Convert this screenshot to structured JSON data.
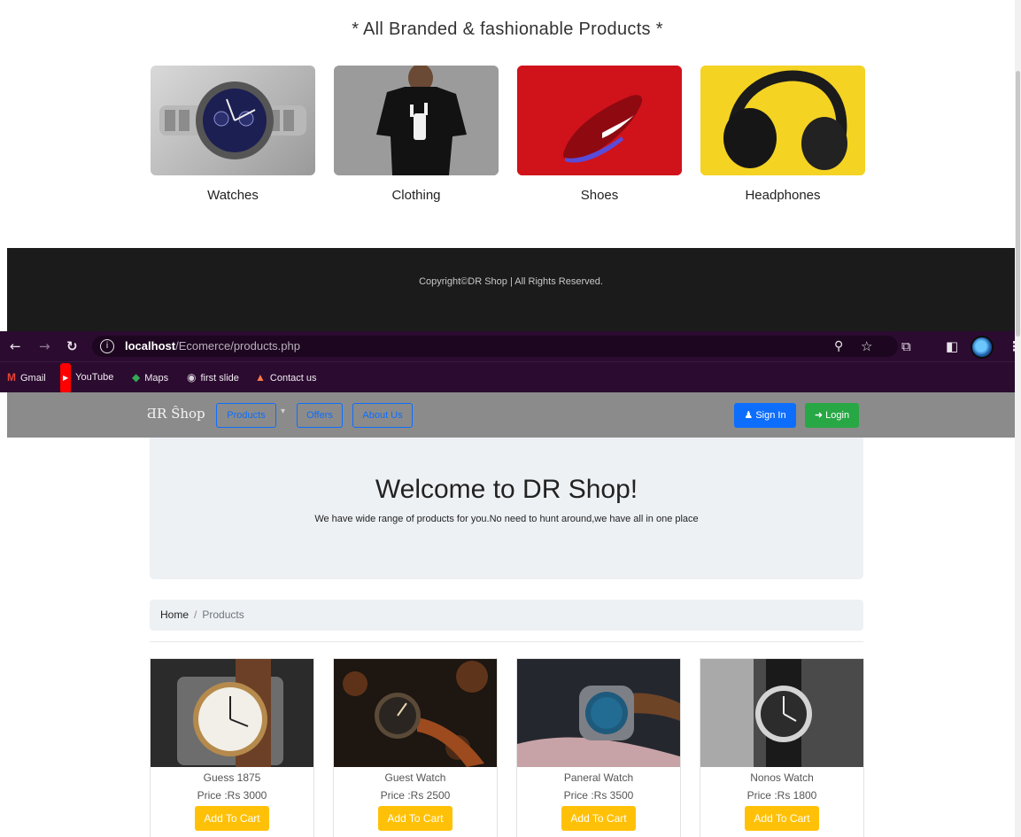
{
  "categories": {
    "title": "* All Branded & fashionable Products *",
    "items": [
      {
        "label": "Watches",
        "icon": "watch-image"
      },
      {
        "label": "Clothing",
        "icon": "tshirt-image"
      },
      {
        "label": "Shoes",
        "icon": "shoe-image"
      },
      {
        "label": "Headphones",
        "icon": "headphones-image"
      }
    ]
  },
  "footer": {
    "copyright": "Copyright©DR Shop | All Rights Reserved."
  },
  "browser": {
    "url_host": "localhost",
    "url_path": "/Ecomerce/products.php",
    "bookmarks": [
      {
        "label": "Gmail",
        "icon": "gmail-icon"
      },
      {
        "label": "YouTube",
        "icon": "youtube-icon"
      },
      {
        "label": "Maps",
        "icon": "maps-icon"
      },
      {
        "label": "first slide",
        "icon": "globe-icon"
      },
      {
        "label": "Contact us",
        "icon": "contact-icon"
      }
    ]
  },
  "navbar": {
    "brand": "ƋR Ŝhop",
    "links": [
      "Products",
      "Offers",
      "About Us"
    ],
    "signin": "Sign In",
    "login": "Login"
  },
  "hero": {
    "title": "Welcome to DR Shop!",
    "subtitle": "We have wide range of products for you.No need to hunt around,we have all in one place"
  },
  "breadcrumb": {
    "home": "Home",
    "separator": "/",
    "current": "Products"
  },
  "products": [
    {
      "name": "Guess 1875",
      "price": "Price :Rs 3000",
      "button": "Add To Cart"
    },
    {
      "name": "Guest Watch",
      "price": "Price :Rs 2500",
      "button": "Add To Cart"
    },
    {
      "name": "Paneral Watch",
      "price": "Price :Rs 3500",
      "button": "Add To Cart"
    },
    {
      "name": "Nonos Watch",
      "price": "Price :Rs 1800",
      "button": "Add To Cart"
    }
  ],
  "colors": {
    "chrome": "#2b0b30",
    "navbar": "#8b8b8b",
    "primary": "#0d6efd",
    "success": "#28a745",
    "warning": "#ffc107",
    "footer": "#1b1b1b"
  }
}
